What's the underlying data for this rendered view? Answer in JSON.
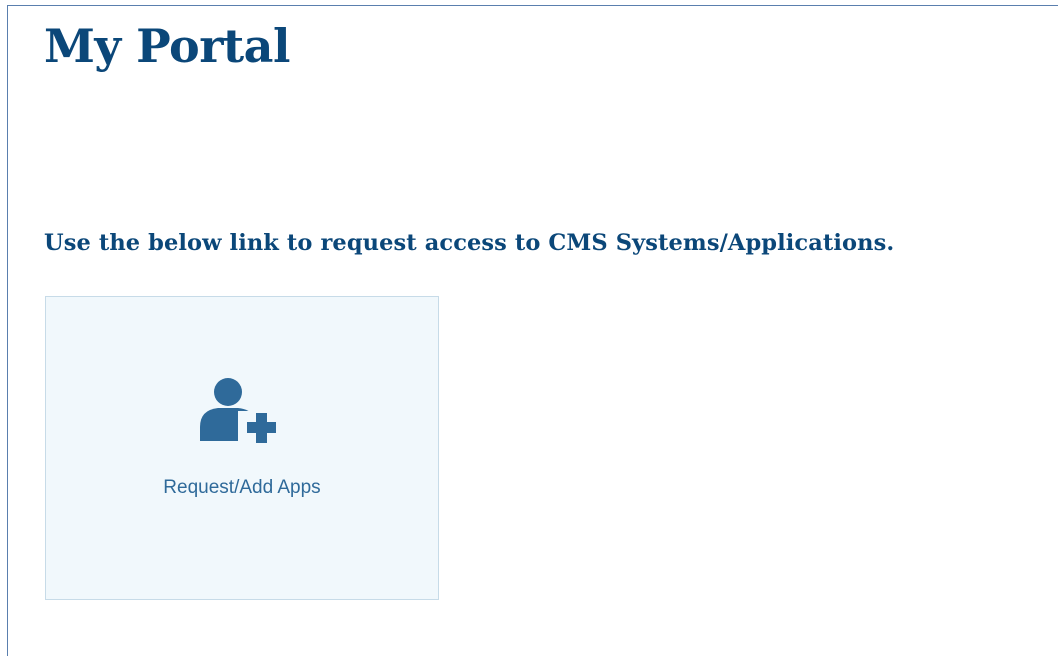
{
  "header": {
    "title": "My Portal"
  },
  "main": {
    "instruction": "Use the below link to request access to CMS Systems/Applications.",
    "tiles": [
      {
        "label": "Request/Add Apps",
        "icon": "user-add-icon"
      }
    ]
  },
  "colors": {
    "heading": "#0b4779",
    "tile_background": "#f1f8fc",
    "tile_border": "#c7dbe8",
    "icon": "#2f6a9a"
  }
}
